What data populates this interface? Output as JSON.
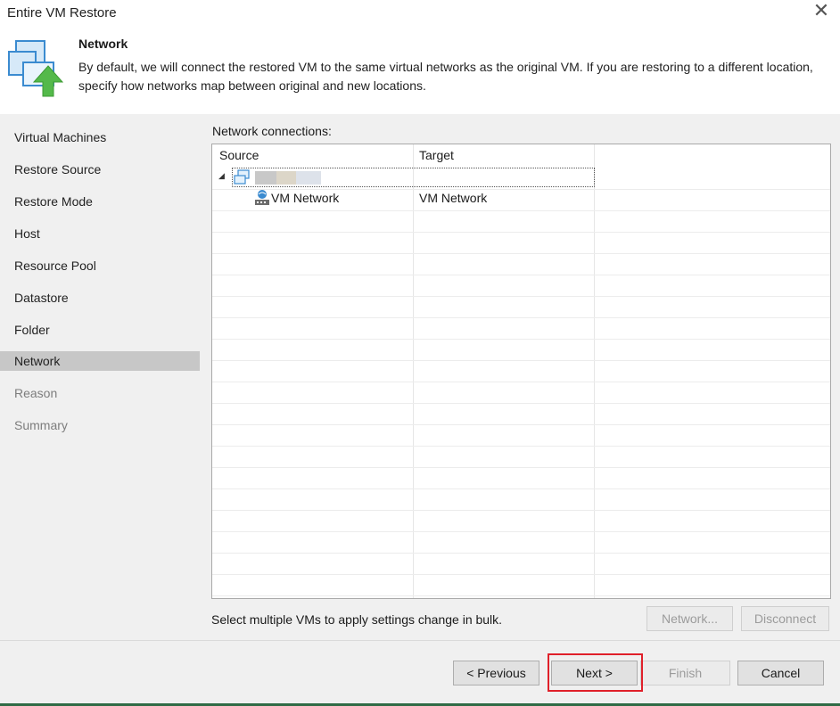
{
  "window": {
    "title": "Entire VM Restore"
  },
  "header": {
    "title": "Network",
    "description": "By default, we will connect the restored VM to the same virtual networks as the original VM. If you are restoring to a different location, specify how networks map between original and new locations."
  },
  "sidebar": {
    "items": [
      {
        "label": "Virtual Machines"
      },
      {
        "label": "Restore Source"
      },
      {
        "label": "Restore Mode"
      },
      {
        "label": "Host"
      },
      {
        "label": "Resource Pool"
      },
      {
        "label": "Datastore"
      },
      {
        "label": "Folder"
      },
      {
        "label": "Network"
      },
      {
        "label": "Reason"
      },
      {
        "label": "Summary"
      }
    ],
    "active": "Network"
  },
  "main": {
    "connections_label": "Network connections:",
    "table": {
      "columns": [
        "Source",
        "Target"
      ],
      "rows": [
        {
          "source": "VM Network",
          "target": "VM Network"
        }
      ]
    },
    "hint": "Select multiple VMs to apply settings change in bulk.",
    "network_button": "Network...",
    "disconnect_button": "Disconnect"
  },
  "footer": {
    "previous": "< Previous",
    "next": "Next >",
    "finish": "Finish",
    "cancel": "Cancel"
  },
  "colors": {
    "panel": "#f0f0f0",
    "selected": "#c7c7c7",
    "highlight": "#e0202a",
    "accent": "#2f6b45"
  },
  "icons": {
    "close": "close-icon",
    "header": "vm-restore-icon",
    "vm": "vm-icon",
    "network": "network-icon"
  }
}
